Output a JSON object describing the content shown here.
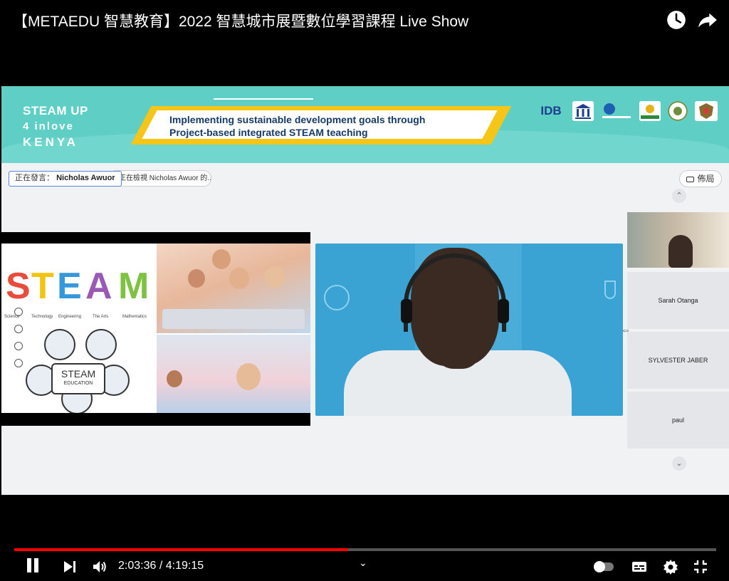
{
  "player": {
    "title": "【METAEDU 智慧教育】2022 智慧城市展暨數位學習課程 Live Show",
    "current_time": "2:03:36",
    "duration": "4:19:15",
    "time_separator": " / ",
    "progress": 0.476
  },
  "banner": {
    "brand_line1": "STEAM UP",
    "brand_line2": "4 inlove",
    "brand_line3": "KENYA",
    "tagline_line1": "Implementing sustainable development goals through",
    "tagline_line2": "Project-based integrated STEAM teaching",
    "logo_idb": "IDB"
  },
  "meeting": {
    "speaking_label": "正在發言：",
    "speaking_name": "Nicholas Awuor",
    "view_label": "正在檢視 Nicholas Awuor 的...",
    "layout_label": "佈局",
    "participants": [
      "Sarah Otanga",
      "SYLVESTER JABER",
      "paul"
    ]
  },
  "slide": {
    "letters": [
      "S",
      "T",
      "E",
      "A",
      "M"
    ],
    "subjects": [
      "Science",
      "Technology",
      "Engineering",
      "The Arts",
      "Mathematics"
    ],
    "hub_line1": "STEAM",
    "hub_line2": "EDUCATION"
  },
  "colors": {
    "progress": "#ff0000",
    "banner": "#5fcfc6",
    "accent_yellow": "#f5c518",
    "speaker_bg": "#3aa3d3"
  }
}
